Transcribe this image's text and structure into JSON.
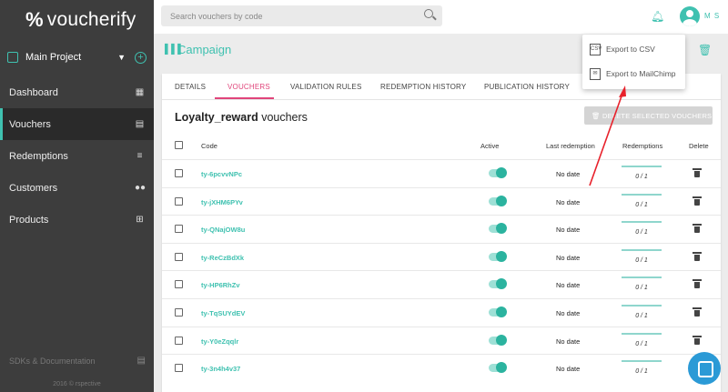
{
  "brand": {
    "logo_text": "voucherify",
    "logo_symbol": "%"
  },
  "sidebar": {
    "project_label": "Main Project",
    "items": [
      {
        "label": "Dashboard",
        "icon": "dashboard-icon"
      },
      {
        "label": "Vouchers",
        "icon": "voucher-icon"
      },
      {
        "label": "Redemptions",
        "icon": "list-icon"
      },
      {
        "label": "Customers",
        "icon": "people-icon"
      },
      {
        "label": "Products",
        "icon": "cart-icon"
      }
    ],
    "sdk_label": "SDKs & Documentation",
    "footer": "2016 © rspective"
  },
  "topbar": {
    "search_placeholder": "Search vouchers by code",
    "user_initials": "M S"
  },
  "campaign": {
    "title": "Campaign"
  },
  "tabs": [
    {
      "label": "DETAILS"
    },
    {
      "label": "VOUCHERS"
    },
    {
      "label": "VALIDATION RULES"
    },
    {
      "label": "REDEMPTION HISTORY"
    },
    {
      "label": "PUBLICATION HISTORY"
    }
  ],
  "vouchers": {
    "campaign_name": "Loyalty_reward",
    "title_suffix": "vouchers",
    "delete_selected_label": "DELETE SELECTED VOUCHERS",
    "columns": {
      "code": "Code",
      "active": "Active",
      "last_redemption": "Last redemption",
      "redemptions": "Redemptions",
      "delete": "Delete"
    },
    "rows": [
      {
        "code": "ty-6pcvvNPc",
        "last_redemption": "No date",
        "redemptions": "0 / 1",
        "redemption_fill": 1.0
      },
      {
        "code": "ty-jXHM6PYv",
        "last_redemption": "No date",
        "redemptions": "0 / 1",
        "redemption_fill": 1.0
      },
      {
        "code": "ty-QNajOW8u",
        "last_redemption": "No date",
        "redemptions": "0 / 1",
        "redemption_fill": 1.0
      },
      {
        "code": "ty-ReCzBdXk",
        "last_redemption": "No date",
        "redemptions": "0 / 1",
        "redemption_fill": 1.0
      },
      {
        "code": "ty-HP6RhZv",
        "last_redemption": "No date",
        "redemptions": "0 / 1",
        "redemption_fill": 1.0
      },
      {
        "code": "ty-TqSUYdEV",
        "last_redemption": "No date",
        "redemptions": "0 / 1",
        "redemption_fill": 1.0
      },
      {
        "code": "ty-Y0eZqqlr",
        "last_redemption": "No date",
        "redemptions": "0 / 1",
        "redemption_fill": 1.0
      },
      {
        "code": "ty-3n4h4v37",
        "last_redemption": "No date",
        "redemptions": "0 / 1",
        "redemption_fill": 1.0
      }
    ]
  },
  "export_menu": {
    "items": [
      {
        "label": "Export to CSV",
        "icon": "csv-file-icon"
      },
      {
        "label": "Export to MailChimp",
        "icon": "mailchimp-icon"
      }
    ]
  },
  "colors": {
    "accent": "#3fc1b0",
    "tab_active": "#e0457b",
    "sidebar_bg": "#3d3d3d",
    "annotation_arrow": "#e8212b",
    "chat_bubble": "#2b9ad6"
  }
}
